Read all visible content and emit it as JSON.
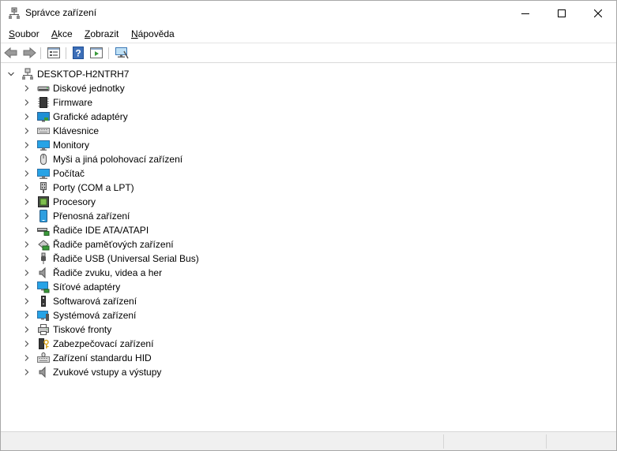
{
  "window": {
    "title": "Správce zařízení"
  },
  "menu": [
    {
      "label": "Soubor",
      "key": "S",
      "rest": "oubor"
    },
    {
      "label": "Akce",
      "key": "A",
      "rest": "kce"
    },
    {
      "label": "Zobrazit",
      "key": "Z",
      "rest": "obrazit"
    },
    {
      "label": "Nápověda",
      "key": "N",
      "rest": "ápověda"
    }
  ],
  "tree": {
    "root": {
      "label": "DESKTOP-H2NTRH7",
      "icon": "computer-icon"
    },
    "items": [
      {
        "label": "Diskové jednotky",
        "icon": "disk-drive-icon"
      },
      {
        "label": "Firmware",
        "icon": "firmware-chip-icon"
      },
      {
        "label": "Grafické adaptéry",
        "icon": "display-adapter-icon"
      },
      {
        "label": "Klávesnice",
        "icon": "keyboard-icon"
      },
      {
        "label": "Monitory",
        "icon": "monitor-icon"
      },
      {
        "label": "Myši a jiná polohovací zařízení",
        "icon": "mouse-icon"
      },
      {
        "label": "Počítač",
        "icon": "computer-monitor-icon"
      },
      {
        "label": "Porty (COM a LPT)",
        "icon": "port-icon"
      },
      {
        "label": "Procesory",
        "icon": "processor-icon"
      },
      {
        "label": "Přenosná zařízení",
        "icon": "portable-device-icon"
      },
      {
        "label": "Řadiče IDE ATA/ATAPI",
        "icon": "ide-controller-icon"
      },
      {
        "label": "Řadiče paměťových zařízení",
        "icon": "storage-controller-icon"
      },
      {
        "label": "Řadiče USB (Universal Serial Bus)",
        "icon": "usb-icon"
      },
      {
        "label": "Řadiče zvuku, videa a her",
        "icon": "speaker-icon"
      },
      {
        "label": "Síťové adaptéry",
        "icon": "network-adapter-icon"
      },
      {
        "label": "Softwarová zařízení",
        "icon": "software-device-icon"
      },
      {
        "label": "Systémová zařízení",
        "icon": "system-device-icon"
      },
      {
        "label": "Tiskové fronty",
        "icon": "printer-icon"
      },
      {
        "label": "Zabezpečovací zařízení",
        "icon": "security-device-icon"
      },
      {
        "label": "Zařízení standardu HID",
        "icon": "hid-icon"
      },
      {
        "label": "Zvukové vstupy a výstupy",
        "icon": "audio-io-icon"
      }
    ]
  },
  "toolbar": [
    {
      "name": "back-button",
      "icon": "arrow-left-icon"
    },
    {
      "name": "forward-button",
      "icon": "arrow-right-icon"
    },
    {
      "name": "properties-button",
      "icon": "properties-icon"
    },
    {
      "name": "help-button",
      "icon": "help-icon"
    },
    {
      "name": "run-button",
      "icon": "run-icon"
    },
    {
      "name": "scan-hardware-button",
      "icon": "scan-monitor-icon"
    }
  ]
}
